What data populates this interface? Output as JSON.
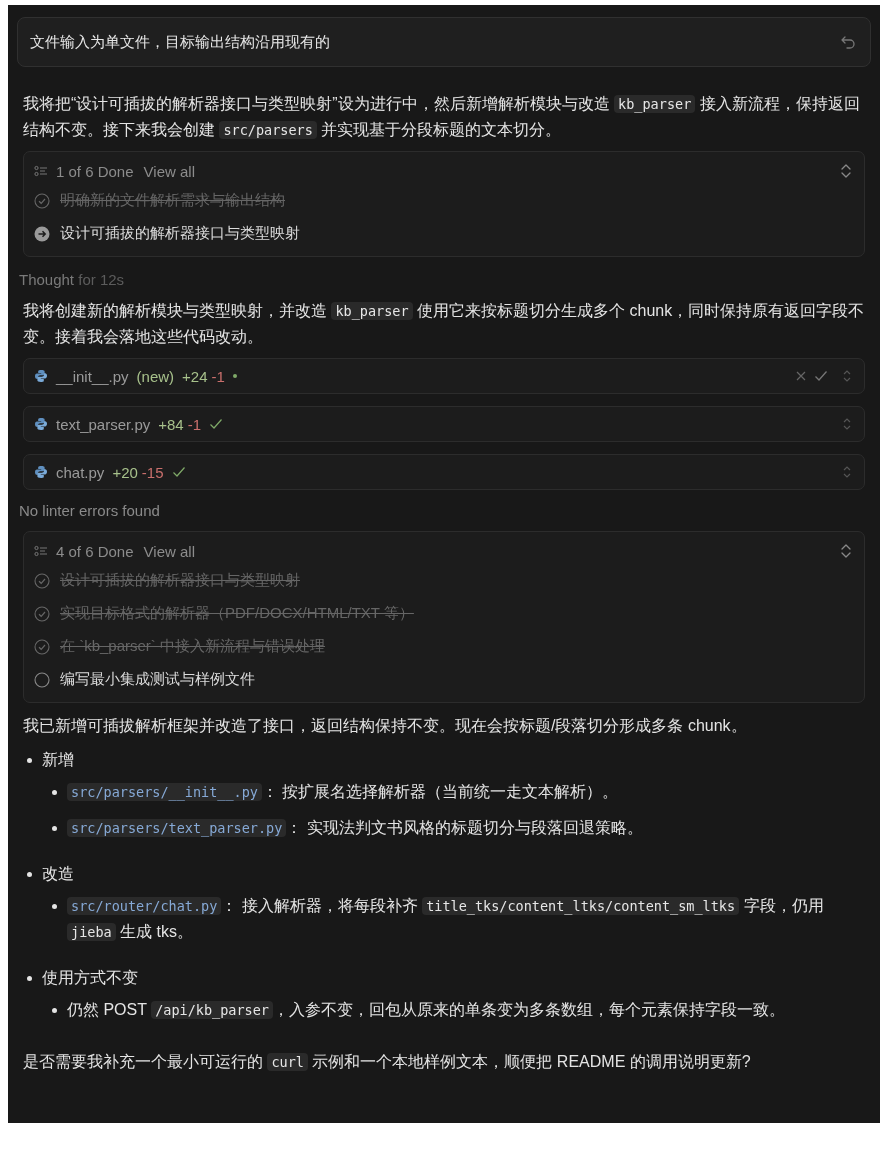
{
  "prompt": {
    "text": "文件输入为单文件，目标输出结构沿用现有的"
  },
  "blocks": [
    {
      "kind": "paragraph",
      "parts": [
        {
          "kind": "text",
          "text": "我将把“设计可插拔的解析器接口与类型映射”设为进行中，然后新增解析模块与改造 "
        },
        {
          "kind": "code",
          "text": "kb_parser"
        },
        {
          "kind": "text",
          "text": " 接入新流程，保持返回结构不变。接下来我会创建 "
        },
        {
          "kind": "code",
          "text": "src/parsers"
        },
        {
          "kind": "text",
          "text": " 并实现基于分段标题的文本切分。"
        }
      ]
    },
    {
      "kind": "todos",
      "summary": "1 of 6 Done",
      "link": "View all",
      "items": [
        {
          "text": "明确新的文件解析需求与输出结构",
          "kind": "done"
        },
        {
          "text": "设计可插拔的解析器接口与类型映射",
          "kind": "active"
        }
      ]
    },
    {
      "kind": "thought",
      "label": "Thought",
      "duration": "for 12s"
    },
    {
      "kind": "paragraph",
      "parts": [
        {
          "kind": "text",
          "text": "我将创建新的解析模块与类型映射，并改造 "
        },
        {
          "kind": "code",
          "text": "kb_parser"
        },
        {
          "kind": "text",
          "text": " 使用它来按标题切分生成多个 chunk，同时保持原有返回字段不变。接着我会落地这些代码改动。"
        }
      ]
    },
    {
      "kind": "file",
      "name": "__init__.py",
      "tag": "(new)",
      "added": "+24",
      "removed": "-1",
      "accepted": false
    },
    {
      "kind": "file",
      "name": "text_parser.py",
      "added": "+84",
      "removed": "-1",
      "accepted": true
    },
    {
      "kind": "file",
      "name": "chat.py",
      "added": "+20",
      "removed": "-15",
      "accepted": true
    },
    {
      "kind": "note",
      "text": "No linter errors found"
    },
    {
      "kind": "todos",
      "summary": "4 of 6 Done",
      "link": "View all",
      "items": [
        {
          "text": "设计可插拔的解析器接口与类型映射",
          "kind": "done"
        },
        {
          "text": "实现目标格式的解析器（PDF/DOCX/HTML/TXT 等）",
          "kind": "done"
        },
        {
          "text": "在 `kb_parser` 中接入新流程与错误处理",
          "kind": "done"
        },
        {
          "text": "编写最小集成测试与样例文件",
          "kind": "pending"
        }
      ]
    },
    {
      "kind": "paragraph",
      "parts": [
        {
          "kind": "text",
          "text": "我已新增可插拔解析框架并改造了接口，返回结构保持不变。现在会按标题/段落切分形成多条 chunk。"
        }
      ]
    },
    {
      "kind": "list",
      "items": [
        {
          "parts": [
            {
              "kind": "text",
              "text": "新增"
            }
          ],
          "children": [
            {
              "parts": [
                {
                  "kind": "path",
                  "text": "src/parsers/__init__.py"
                },
                {
                  "kind": "text",
                  "text": "： 按扩展名选择解析器（当前统一走文本解析）。"
                }
              ]
            },
            {
              "parts": [
                {
                  "kind": "path",
                  "text": "src/parsers/text_parser.py"
                },
                {
                  "kind": "text",
                  "text": "： 实现法判文书风格的标题切分与段落回退策略。"
                }
              ]
            }
          ]
        },
        {
          "parts": [
            {
              "kind": "text",
              "text": "改造"
            }
          ],
          "children": [
            {
              "parts": [
                {
                  "kind": "path",
                  "text": "src/router/chat.py"
                },
                {
                  "kind": "text",
                  "text": "： 接入解析器，将每段补齐 "
                },
                {
                  "kind": "code",
                  "text": "title_tks/content_ltks/content_sm_ltks"
                },
                {
                  "kind": "text",
                  "text": " 字段，仍用 "
                },
                {
                  "kind": "code",
                  "text": "jieba"
                },
                {
                  "kind": "text",
                  "text": " 生成 tks。"
                }
              ]
            }
          ]
        },
        {
          "parts": [
            {
              "kind": "text",
              "text": "使用方式不变"
            }
          ],
          "children": [
            {
              "parts": [
                {
                  "kind": "text",
                  "text": "仍然 POST "
                },
                {
                  "kind": "code",
                  "text": "/api/kb_parser"
                },
                {
                  "kind": "text",
                  "text": "，入参不变，回包从原来的单条变为多条数组，每个元素保持字段一致。"
                }
              ]
            }
          ]
        }
      ]
    },
    {
      "kind": "paragraph",
      "parts": [
        {
          "kind": "text",
          "text": "是否需要我补充一个最小可运行的 "
        },
        {
          "kind": "code",
          "text": "curl"
        },
        {
          "kind": "text",
          "text": " 示例和一个本地样例文本，顺便把 README 的调用说明更新?"
        }
      ]
    }
  ]
}
